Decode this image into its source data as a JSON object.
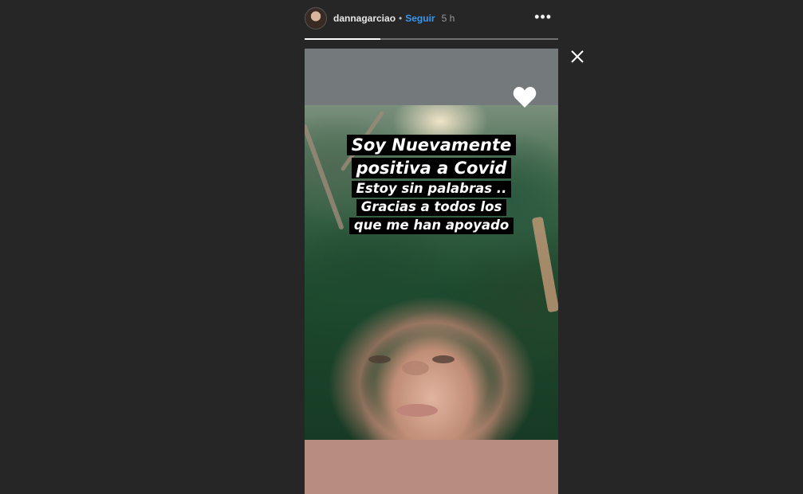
{
  "header": {
    "username": "dannagarciao",
    "separator": "•",
    "follow_label": "Seguir",
    "time": "5 h",
    "more_label": "•••"
  },
  "progress": {
    "fraction": 0.3
  },
  "story": {
    "caption_lines": [
      "Soy Nuevamente",
      "positiva a Covid",
      "Estoy sin palabras ..",
      "Gracias a todos los",
      "que me han apoyado"
    ]
  },
  "icons": {
    "close": "close-icon",
    "heart": "heart-icon",
    "more": "more-icon"
  },
  "colors": {
    "background": "#262626",
    "follow": "#3897f0",
    "caption_bg": "#000000",
    "caption_text": "#ffffff"
  }
}
